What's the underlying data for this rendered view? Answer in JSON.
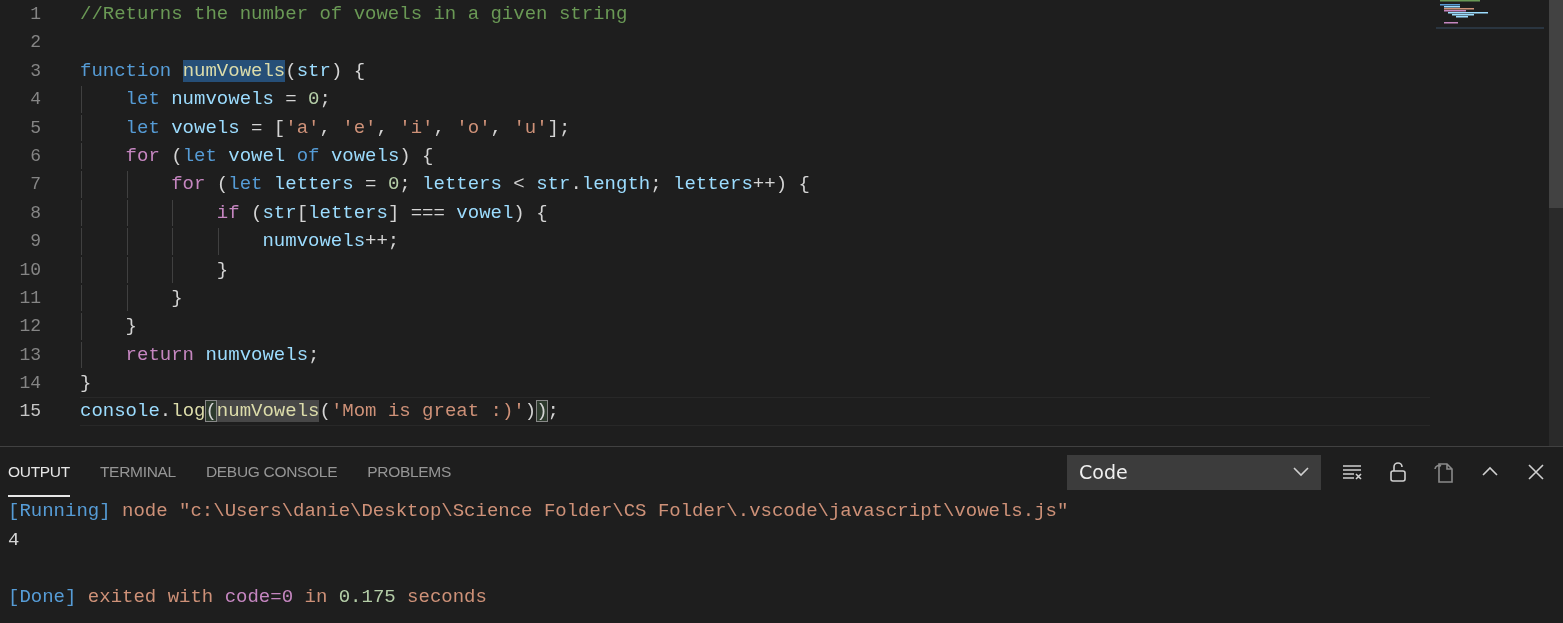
{
  "editor": {
    "lines": [
      {
        "number": "1",
        "current": false,
        "tokens": [
          {
            "kind": "comment",
            "text": "//Returns the number of vowels in a given string"
          }
        ]
      },
      {
        "number": "2",
        "current": false
      },
      {
        "number": "3",
        "current": false,
        "tokens": [
          {
            "kind": "keyword",
            "text": "function "
          },
          {
            "kind": "func",
            "text": "numVowels",
            "selection": true
          },
          {
            "kind": "punct",
            "text": "("
          },
          {
            "kind": "var",
            "text": "str"
          },
          {
            "kind": "punct",
            "text": ") {"
          }
        ]
      },
      {
        "number": "4",
        "current": false,
        "tokens": [
          {
            "kind": "keyword",
            "text": "    let "
          },
          {
            "kind": "var",
            "text": "numvowels"
          },
          {
            "kind": "punct",
            "text": " = "
          },
          {
            "kind": "number",
            "text": "0"
          },
          {
            "kind": "punct",
            "text": ";"
          }
        ]
      },
      {
        "number": "5",
        "current": false,
        "tokens": [
          {
            "kind": "keyword",
            "text": "    let "
          },
          {
            "kind": "var",
            "text": "vowels"
          },
          {
            "kind": "punct",
            "text": " = ["
          },
          {
            "kind": "string",
            "text": "'a'"
          },
          {
            "kind": "punct",
            "text": ", "
          },
          {
            "kind": "string",
            "text": "'e'"
          },
          {
            "kind": "punct",
            "text": ", "
          },
          {
            "kind": "string",
            "text": "'i'"
          },
          {
            "kind": "punct",
            "text": ", "
          },
          {
            "kind": "string",
            "text": "'o'"
          },
          {
            "kind": "punct",
            "text": ", "
          },
          {
            "kind": "string",
            "text": "'u'"
          },
          {
            "kind": "punct",
            "text": "];"
          }
        ]
      },
      {
        "number": "6",
        "current": false,
        "tokens": [
          {
            "kind": "control",
            "text": "    for"
          },
          {
            "kind": "punct",
            "text": " ("
          },
          {
            "kind": "keyword",
            "text": "let "
          },
          {
            "kind": "var",
            "text": "vowel "
          },
          {
            "kind": "keyword",
            "text": "of "
          },
          {
            "kind": "var",
            "text": "vowels"
          },
          {
            "kind": "punct",
            "text": ") {"
          }
        ]
      },
      {
        "number": "7",
        "current": false,
        "tokens": [
          {
            "kind": "control",
            "text": "        for"
          },
          {
            "kind": "punct",
            "text": " ("
          },
          {
            "kind": "keyword",
            "text": "let "
          },
          {
            "kind": "var",
            "text": "letters"
          },
          {
            "kind": "punct",
            "text": " = "
          },
          {
            "kind": "number",
            "text": "0"
          },
          {
            "kind": "punct",
            "text": "; "
          },
          {
            "kind": "var",
            "text": "letters"
          },
          {
            "kind": "punct",
            "text": " < "
          },
          {
            "kind": "var",
            "text": "str"
          },
          {
            "kind": "punct",
            "text": "."
          },
          {
            "kind": "var",
            "text": "length"
          },
          {
            "kind": "punct",
            "text": "; "
          },
          {
            "kind": "var",
            "text": "letters"
          },
          {
            "kind": "punct",
            "text": "++) {"
          }
        ]
      },
      {
        "number": "8",
        "current": false,
        "tokens": [
          {
            "kind": "control",
            "text": "            if"
          },
          {
            "kind": "punct",
            "text": " ("
          },
          {
            "kind": "var",
            "text": "str"
          },
          {
            "kind": "punct",
            "text": "["
          },
          {
            "kind": "var",
            "text": "letters"
          },
          {
            "kind": "punct",
            "text": "] === "
          },
          {
            "kind": "var",
            "text": "vowel"
          },
          {
            "kind": "punct",
            "text": ") {"
          }
        ]
      },
      {
        "number": "9",
        "current": false,
        "tokens": [
          {
            "kind": "var",
            "text": "                numvowels"
          },
          {
            "kind": "punct",
            "text": "++;"
          }
        ]
      },
      {
        "number": "10",
        "current": false,
        "tokens": [
          {
            "kind": "punct",
            "text": "            }"
          }
        ]
      },
      {
        "number": "11",
        "current": false,
        "tokens": [
          {
            "kind": "punct",
            "text": "        }"
          }
        ]
      },
      {
        "number": "12",
        "current": false,
        "tokens": [
          {
            "kind": "punct",
            "text": "    }"
          }
        ]
      },
      {
        "number": "13",
        "current": false,
        "tokens": [
          {
            "kind": "control",
            "text": "    return "
          },
          {
            "kind": "var",
            "text": "numvowels"
          },
          {
            "kind": "punct",
            "text": ";"
          }
        ]
      },
      {
        "number": "14",
        "current": false,
        "tokens": [
          {
            "kind": "punct",
            "text": "}"
          }
        ]
      },
      {
        "number": "15",
        "current": true,
        "tokens": [
          {
            "kind": "var",
            "text": "console"
          },
          {
            "kind": "punct",
            "text": "."
          },
          {
            "kind": "func",
            "text": "log"
          },
          {
            "kind": "punct",
            "text": "(",
            "bracket_match": true
          },
          {
            "kind": "func",
            "text": "numVowels",
            "occurrence": true
          },
          {
            "kind": "punct",
            "text": "("
          },
          {
            "kind": "string",
            "text": "'Mom is great :)'"
          },
          {
            "kind": "punct",
            "text": ")"
          },
          {
            "kind": "punct",
            "text": ")",
            "bracket_match": true
          },
          {
            "kind": "punct",
            "text": ";"
          }
        ]
      }
    ]
  },
  "panel": {
    "tabs": [
      {
        "label": "OUTPUT",
        "selected": true
      },
      {
        "label": "TERMINAL",
        "selected": false
      },
      {
        "label": "DEBUG CONSOLE",
        "selected": false
      },
      {
        "label": "PROBLEMS",
        "selected": false
      }
    ],
    "channel": {
      "value": "Code"
    },
    "output": [
      {
        "kind": "command",
        "tokens": [
          {
            "kind": "tag",
            "text": "[Running]"
          },
          {
            "kind": "string",
            "text": " node \"c:\\Users\\danie\\Desktop\\Science Folder\\CS Folder\\.vscode\\javascript\\vowels.js\""
          }
        ]
      },
      {
        "kind": "result",
        "tokens": [
          {
            "kind": "plain",
            "text": "4"
          }
        ]
      },
      {
        "kind": "summary",
        "tokens": [
          {
            "kind": "tag",
            "text": "[Done]"
          },
          {
            "kind": "string",
            "text": " exited with "
          },
          {
            "kind": "control",
            "text": "code=0"
          },
          {
            "kind": "string",
            "text": " in "
          },
          {
            "kind": "number",
            "text": "0.175"
          },
          {
            "kind": "string",
            "text": " seconds"
          }
        ]
      }
    ]
  }
}
